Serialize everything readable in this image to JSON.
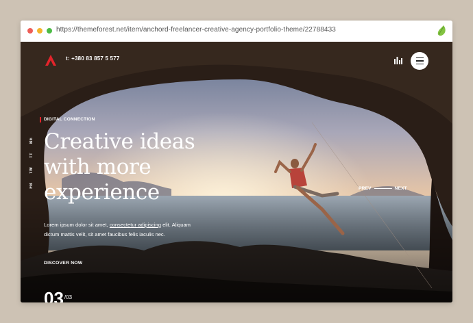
{
  "browser": {
    "url": "https://themeforest.net/item/anchord-freelancer-creative-agency-portfolio-theme/22788433"
  },
  "header": {
    "phone": "t: +380 83 857 5 577"
  },
  "hero": {
    "kicker": "DIGITAL CONNECTION",
    "headline": [
      "Creative ideas",
      "with more",
      "experience"
    ],
    "paragraph_before_link": "Lorem ipsum dolor sit amet, ",
    "paragraph_link": "consectetur adipiscing",
    "paragraph_after_link": " elit. Aliquam dictum mattis velit, sit amet faucibus felis iaculis nec.",
    "cta": "DISCOVER NOW",
    "prev_label": "PREV",
    "next_label": "NEXT",
    "slide_current": "03",
    "slide_total": "/03"
  },
  "social": [
    "BE",
    "TT",
    "TW",
    "FB"
  ],
  "icons": {
    "logo": "anchord-logo",
    "stats": "bar-chart-icon",
    "menu": "hamburger-menu-icon",
    "browser_leaf": "envato-leaf-icon"
  },
  "colors": {
    "accent": "#e3242b",
    "page_bg": "#cdc2b4"
  }
}
